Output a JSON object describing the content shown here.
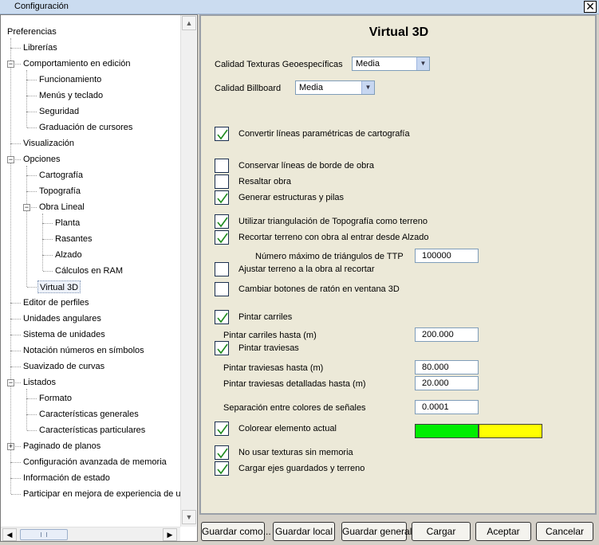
{
  "window": {
    "title": "Configuración"
  },
  "tree": {
    "items": [
      {
        "label": "Preferencias",
        "level": 0
      },
      {
        "label": "Librerías",
        "level": 1
      },
      {
        "label": "Comportamiento en edición",
        "level": 1,
        "expander": "-"
      },
      {
        "label": "Funcionamiento",
        "level": 2
      },
      {
        "label": "Menús y teclado",
        "level": 2
      },
      {
        "label": "Seguridad",
        "level": 2
      },
      {
        "label": "Graduación de cursores",
        "level": 2
      },
      {
        "label": "Visualización",
        "level": 1
      },
      {
        "label": "Opciones",
        "level": 1,
        "expander": "-"
      },
      {
        "label": "Cartografía",
        "level": 2
      },
      {
        "label": "Topografía",
        "level": 2
      },
      {
        "label": "Obra Lineal",
        "level": 2,
        "expander": "-"
      },
      {
        "label": "Planta",
        "level": 3
      },
      {
        "label": "Rasantes",
        "level": 3
      },
      {
        "label": "Alzado",
        "level": 3
      },
      {
        "label": "Cálculos en RAM",
        "level": 3
      },
      {
        "label": "Virtual 3D",
        "level": 2,
        "selected": true
      },
      {
        "label": "Editor de perfiles",
        "level": 1
      },
      {
        "label": "Unidades angulares",
        "level": 1
      },
      {
        "label": "Sistema de unidades",
        "level": 1
      },
      {
        "label": "Notación números en símbolos",
        "level": 1
      },
      {
        "label": "Suavizado de curvas",
        "level": 1
      },
      {
        "label": "Listados",
        "level": 1,
        "expander": "-"
      },
      {
        "label": "Formato",
        "level": 2
      },
      {
        "label": "Características generales",
        "level": 2
      },
      {
        "label": "Características particulares",
        "level": 2
      },
      {
        "label": "Paginado de planos",
        "level": 1,
        "expander": "+"
      },
      {
        "label": "Configuración avanzada de memoria",
        "level": 1
      },
      {
        "label": "Información de estado",
        "level": 1
      },
      {
        "label": "Participar en mejora de experiencia de usu",
        "level": 1
      }
    ]
  },
  "panel": {
    "title": "Virtual 3D",
    "calidad_texturas_label": "Calidad Texturas Geoespecíficas",
    "calidad_texturas_value": "Media",
    "calidad_billboard_label": "Calidad Billboard",
    "calidad_billboard_value": "Media",
    "checks": {
      "convertir_lineas": {
        "label": "Convertir líneas paramétricas de cartografía",
        "checked": true
      },
      "conservar_lineas": {
        "label": "Conservar líneas de borde de obra",
        "checked": false
      },
      "resaltar_obra": {
        "label": "Resaltar obra",
        "checked": false
      },
      "generar_estructuras": {
        "label": "Generar estructuras y pilas",
        "checked": true
      },
      "utilizar_triangulacion": {
        "label": "Utilizar triangulación de Topografía como terreno",
        "checked": true
      },
      "recortar_terreno": {
        "label": "Recortar terreno con obra al entrar desde Alzado",
        "checked": true
      },
      "ajustar_terreno": {
        "label": "Ajustar terreno a la obra al recortar",
        "checked": false
      },
      "cambiar_botones": {
        "label": "Cambiar botones de ratón en ventana 3D",
        "checked": false
      },
      "pintar_carriles": {
        "label": "Pintar carriles",
        "checked": true
      },
      "pintar_traviesas": {
        "label": "Pintar traviesas",
        "checked": true
      },
      "colorear_elemento": {
        "label": "Colorear elemento actual",
        "checked": true
      },
      "no_usar_texturas": {
        "label": "No usar texturas sin memoria",
        "checked": true
      },
      "cargar_ejes": {
        "label": "Cargar ejes guardados y terreno",
        "checked": true
      }
    },
    "fields": {
      "num_triangulos": {
        "label": "Número máximo de triángulos de TTP",
        "value": "100000"
      },
      "carriles_hasta": {
        "label": "Pintar carriles hasta (m)",
        "value": "200.000"
      },
      "traviesas_hasta": {
        "label": "Pintar traviesas hasta (m)",
        "value": "80.000"
      },
      "traviesas_detalladas": {
        "label": "Pintar traviesas detalladas hasta (m)",
        "value": "20.000"
      },
      "separacion_colores": {
        "label": "Separación entre colores de señales",
        "value": "0.0001"
      }
    },
    "colors": {
      "color1": "#00ee00",
      "color2": "#ffff00"
    }
  },
  "buttons": {
    "guardar_como": "Guardar como...",
    "guardar_local": "Guardar local",
    "guardar_general": "Guardar general",
    "cargar": "Cargar",
    "aceptar": "Aceptar",
    "cancelar": "Cancelar"
  },
  "icons": {
    "close": "close-icon",
    "check": "check-icon"
  }
}
